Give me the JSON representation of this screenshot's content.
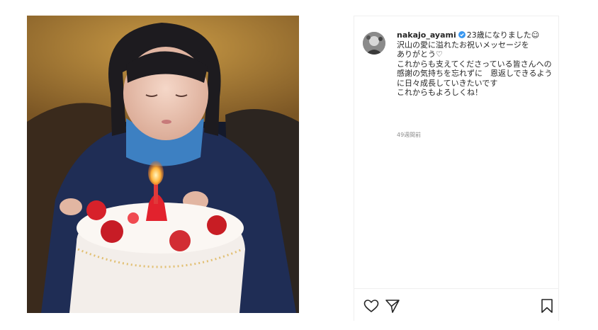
{
  "post": {
    "username": "nakajo_ayami",
    "caption": "23歳になりました☺︎\n沢山の愛に溢れたお祝いメッセージを\nありがとう♡\nこれからも支えてくださっている皆さんへの感謝の気持ちを忘れずに　恩返しできるように日々成長していきたいです\nこれからもよろしくね！",
    "timestamp": "49週間前"
  },
  "icons": {
    "verified": "verified-badge-icon",
    "like": "heart-icon",
    "share": "paper-plane-icon",
    "save": "bookmark-icon"
  },
  "colors": {
    "verified": "#3897f0",
    "text": "#262626",
    "muted": "#8e8e8e"
  }
}
